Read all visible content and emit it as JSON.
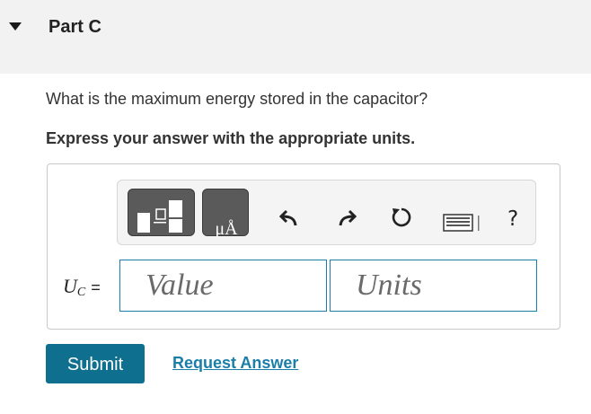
{
  "part": {
    "title": "Part C"
  },
  "question": {
    "text": "What is the maximum energy stored in the capacitor?",
    "instruction": "Express your answer with the appropriate units."
  },
  "toolbar": {
    "buttons": [
      {
        "icon": "templates-icon"
      },
      {
        "icon": "units-micro-angstrom-icon",
        "glyph": "μÅ"
      },
      {
        "icon": "undo-icon"
      },
      {
        "icon": "redo-icon"
      },
      {
        "icon": "reset-icon"
      },
      {
        "icon": "keyboard-icon"
      },
      {
        "icon": "help-icon",
        "glyph": "?"
      }
    ]
  },
  "answer": {
    "variable": "U",
    "subscript": "C",
    "equals": "=",
    "value_placeholder": "Value",
    "units_placeholder": "Units"
  },
  "actions": {
    "submit_label": "Submit",
    "request_label": "Request Answer"
  },
  "colors": {
    "header_bg": "#f2f2f2",
    "accent": "#1a7ea8",
    "submit_bg": "#0f6f8f",
    "tool_button_bg": "#5a5a5a"
  }
}
